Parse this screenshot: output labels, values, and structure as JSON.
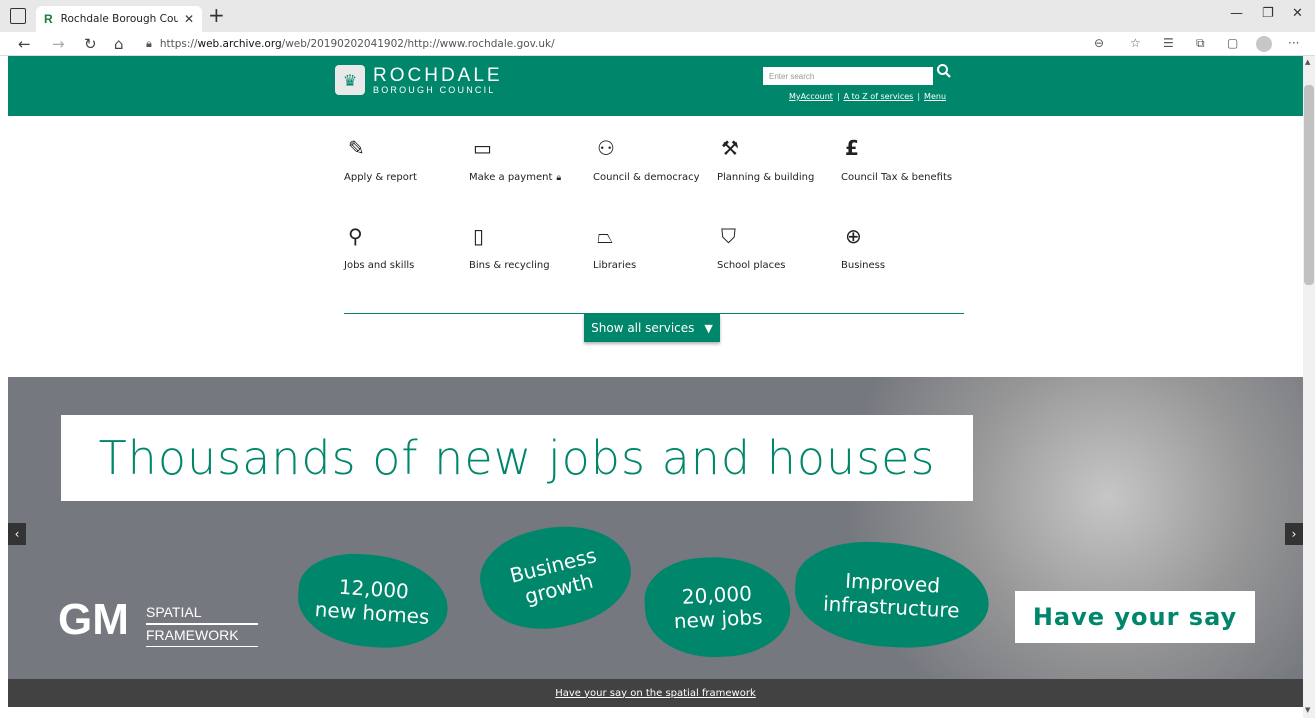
{
  "browser": {
    "tab_title": "Rochdale Borough Council - Hon",
    "favicon_letter": "R",
    "url_prefix": "https://",
    "url_host": "web.archive.org",
    "url_path": "/web/20190202041902/http://www.rochdale.gov.uk/"
  },
  "header": {
    "logo_main": "ROCHDALE",
    "logo_sub": "BOROUGH COUNCIL",
    "search_placeholder": "Enter search",
    "links": [
      "MyAccount",
      "A to Z of services",
      "Menu"
    ],
    "link_separator": "|",
    "accent_color": "#00866a"
  },
  "services": [
    {
      "label": "Apply & report",
      "icon": "pencil-square-icon"
    },
    {
      "label": "Make a payment",
      "icon": "card-icon"
    },
    {
      "label": "Council & democracy",
      "icon": "people-icon"
    },
    {
      "label": "Planning & building",
      "icon": "hammer-icon"
    },
    {
      "label": "Council Tax & benefits",
      "icon": "pound-icon"
    },
    {
      "label": "Jobs and skills",
      "icon": "search-icon"
    },
    {
      "label": "Bins & recycling",
      "icon": "bin-icon"
    },
    {
      "label": "Libraries",
      "icon": "book-icon"
    },
    {
      "label": "School places",
      "icon": "graduation-cap-icon"
    },
    {
      "label": "Business",
      "icon": "globe-icon"
    }
  ],
  "show_all": "Show all services",
  "banner": {
    "headline": "Thousands of new jobs and houses",
    "gm": "GM",
    "spatial": "SPATIAL",
    "framework": "FRAMEWORK",
    "blobs": [
      "12,000\nnew homes",
      "Business\ngrowth",
      "20,000\nnew jobs",
      "Improved\ninfrastructure"
    ],
    "have_say": "Have your say"
  },
  "caption": "Have your say on the spatial framework"
}
